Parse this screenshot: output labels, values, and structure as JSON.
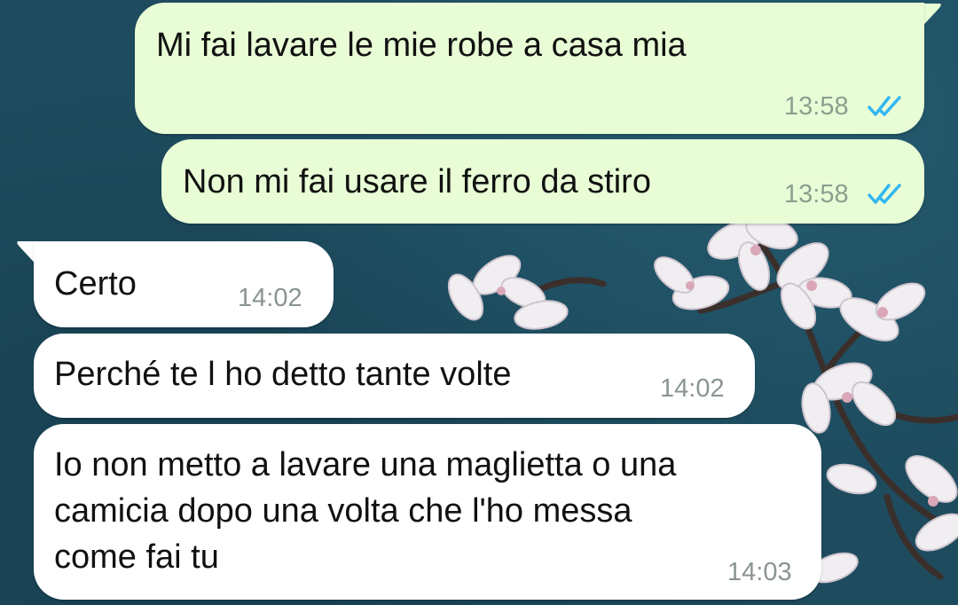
{
  "colors": {
    "background": "#1e4b5e",
    "outgoing_bubble": "#e8fdd6",
    "incoming_bubble": "#ffffff",
    "read_check": "#34b7f1",
    "timestamp": "#8a9590"
  },
  "messages": [
    {
      "direction": "outgoing",
      "text": "Mi fai lavare le mie robe a casa mia",
      "time": "13:58",
      "status_icon": "double-check-read-icon"
    },
    {
      "direction": "outgoing",
      "text": "Non mi fai usare il ferro da stiro",
      "time": "13:58",
      "status_icon": "double-check-read-icon"
    },
    {
      "direction": "incoming",
      "text": "Certo",
      "time": "14:02"
    },
    {
      "direction": "incoming",
      "text": "Perché te l ho detto tante volte",
      "time": "14:02"
    },
    {
      "direction": "incoming",
      "text": "Io non metto a lavare una maglietta o una\ncamicia dopo una volta che l'ho messa\ncome fai tu",
      "time": "14:03"
    }
  ]
}
